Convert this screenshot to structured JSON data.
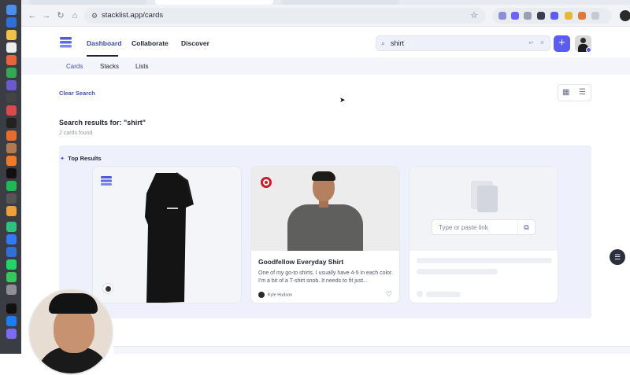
{
  "browser": {
    "url": "stacklist.app/cards",
    "icons": [
      "back-icon",
      "forward-icon",
      "reload-icon",
      "home-icon",
      "star-icon",
      "menu-icon"
    ]
  },
  "header": {
    "nav": [
      {
        "label": "Dashboard",
        "active": true
      },
      {
        "label": "Collaborate",
        "active": false
      },
      {
        "label": "Discover",
        "active": false
      }
    ],
    "search_value": "shirt",
    "add_label": "+"
  },
  "subnav": {
    "tabs": [
      {
        "label": "Cards",
        "active": true
      },
      {
        "label": "Stacks",
        "active": false
      },
      {
        "label": "Lists",
        "active": false
      }
    ]
  },
  "toolbar": {
    "clear_search": "Clear Search"
  },
  "results": {
    "heading": "Search results for: \"shirt\"",
    "count": "2 cards found",
    "section_title": "Top Results"
  },
  "cards": [
    {
      "type": "product-image",
      "source_icon": "stacklist-icon"
    },
    {
      "type": "product",
      "source_icon": "target-icon",
      "title": "Goodfellow Everyday Shirt",
      "description": "One of my go-to shirts. I usually have 4-5 in each color. I'm a bit of a T-shirt snob. It needs to fit just...",
      "author": "Kyle Hudson"
    },
    {
      "type": "add-card",
      "link_placeholder": "Type or paste link"
    }
  ],
  "colors": {
    "accent": "#5b5cf0",
    "link": "#4451b5",
    "panel": "#eef1fb",
    "target_red": "#cc1b2a"
  }
}
